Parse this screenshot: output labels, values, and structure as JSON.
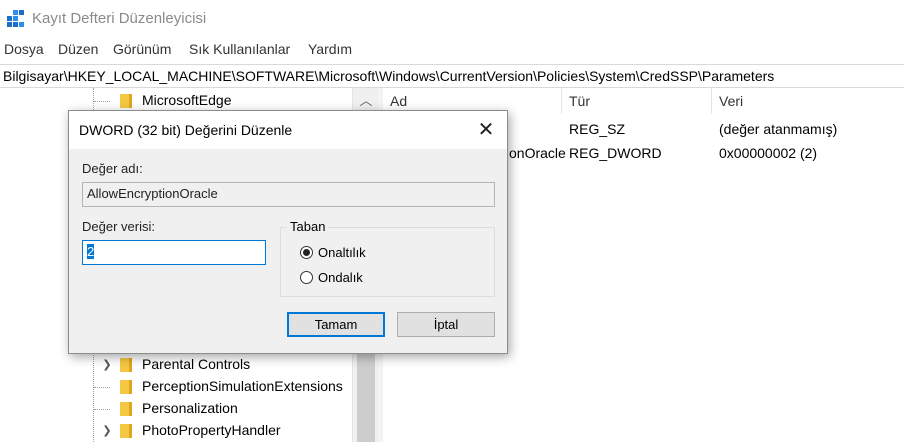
{
  "window": {
    "title": "Kayıt Defteri Düzenleyicisi"
  },
  "menu": [
    "Dosya",
    "Düzen",
    "Görünüm",
    "Sık Kullanılanlar",
    "Yardım"
  ],
  "address": "Bilgisayar\\HKEY_LOCAL_MACHINE\\SOFTWARE\\Microsoft\\Windows\\CurrentVersion\\Policies\\System\\CredSSP\\Parameters",
  "tree": {
    "top_item": "MicrosoftEdge",
    "bottom_items": [
      {
        "label": "Parental Controls",
        "expandable": true
      },
      {
        "label": "PerceptionSimulationExtensions",
        "expandable": false
      },
      {
        "label": "Personalization",
        "expandable": false
      },
      {
        "label": "PhotoPropertyHandler",
        "expandable": true
      }
    ]
  },
  "list": {
    "columns": [
      "Ad",
      "Tür",
      "Veri"
    ],
    "rows": [
      {
        "name": "",
        "type": "REG_SZ",
        "data": "(değer atanmamış)"
      },
      {
        "name": "onOracle",
        "type": "REG_DWORD",
        "data": "0x00000002 (2)"
      }
    ]
  },
  "dialog": {
    "title": "DWORD (32 bit) Değerini Düzenle",
    "close_glyph": "✕",
    "name_label": "Değer adı:",
    "name_value": "AllowEncryptionOracle",
    "data_label": "Değer verisi:",
    "data_value": "2",
    "base_label": "Taban",
    "base_options": [
      "Onaltılık",
      "Ondalık"
    ],
    "base_selected": "Onaltılık",
    "ok_label": "Tamam",
    "cancel_label": "İptal"
  },
  "colors": {
    "accent": "#0078d7",
    "window_bg": "#f0f0f0"
  },
  "icons": {
    "app": "registry-cubes-icon",
    "folder": "folder-icon",
    "scroll_up": "chevron-up-icon",
    "expander": "chevron-right-icon"
  }
}
